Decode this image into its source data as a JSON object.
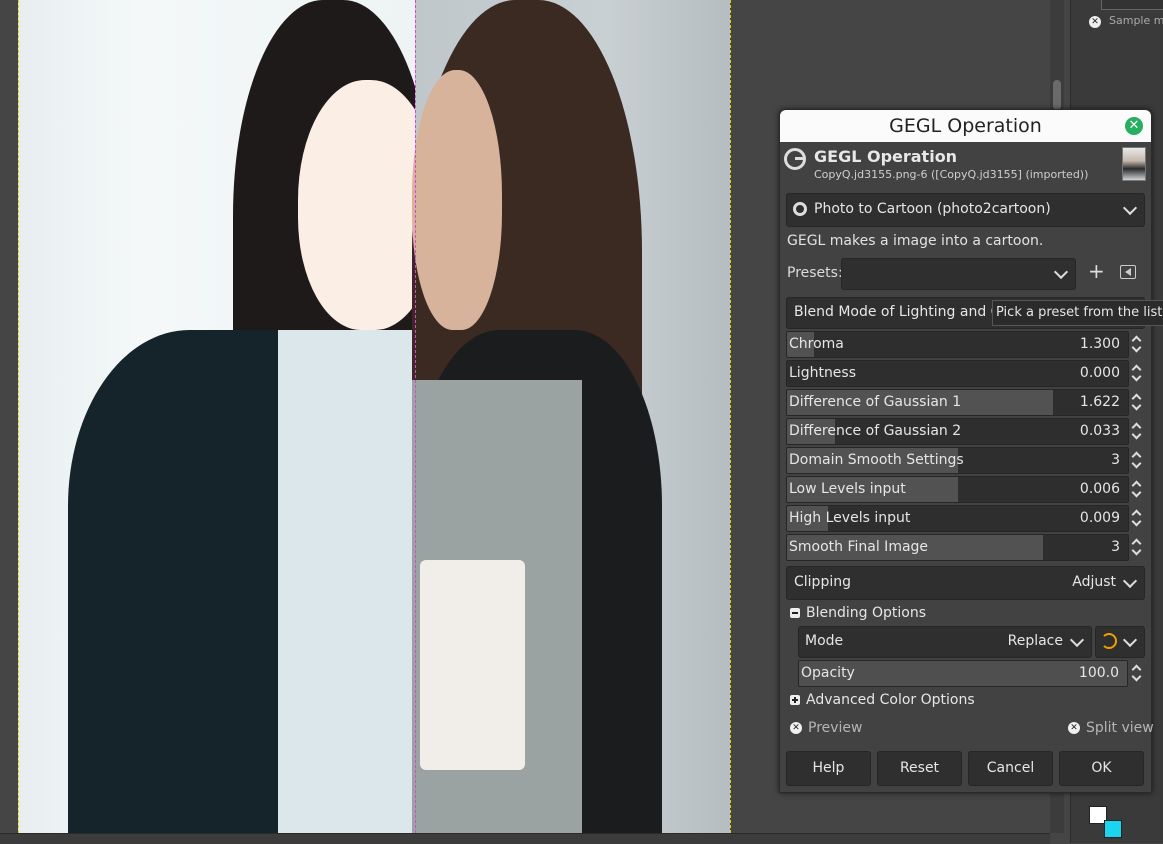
{
  "dialog": {
    "title": "GEGL Operation",
    "header_name": "GEGL Operation",
    "header_subtitle": "CopyQ.jd3155.png-6 ([CopyQ.jd3155] (imported))",
    "operation": "Photo to Cartoon (photo2cartoon)",
    "description": "GEGL makes a image into a cartoon.",
    "presets_label": "Presets:",
    "presets_value": "",
    "blend_mode_label": "Blend Mode of Lighting and Chro",
    "tooltip": "Pick a preset from the list",
    "sliders": [
      {
        "label": "Chroma",
        "value": "1.300",
        "fill": 0.08
      },
      {
        "label": "Lightness",
        "value": "0.000",
        "fill": 0.0
      },
      {
        "label": "Difference of Gaussian 1",
        "value": "1.622",
        "fill": 0.78
      },
      {
        "label": "Difference of Gaussian 2",
        "value": "0.033",
        "fill": 0.14
      },
      {
        "label": "Domain Smooth Settings",
        "value": "3",
        "fill": 0.5
      },
      {
        "label": "Low Levels input",
        "value": "0.006",
        "fill": 0.5
      },
      {
        "label": "High Levels input",
        "value": "0.009",
        "fill": 0.12
      },
      {
        "label": "Smooth Final Image",
        "value": "3",
        "fill": 0.75
      }
    ],
    "clipping_label": "Clipping",
    "clipping_value": "Adjust",
    "blending_options": "Blending Options",
    "mode_label": "Mode",
    "mode_value": "Replace",
    "opacity_label": "Opacity",
    "opacity_value": "100.0",
    "advanced_color_options": "Advanced Color Options",
    "preview_label": "Preview",
    "split_view_label": "Split view",
    "buttons": {
      "help": "Help",
      "reset": "Reset",
      "cancel": "Cancel",
      "ok": "OK"
    }
  },
  "dock": {
    "sample_text": "Sample m"
  },
  "colors": {
    "accent_close": "#27ae60",
    "background_color": "#19d6f0",
    "split_guide": "#e040e0"
  }
}
